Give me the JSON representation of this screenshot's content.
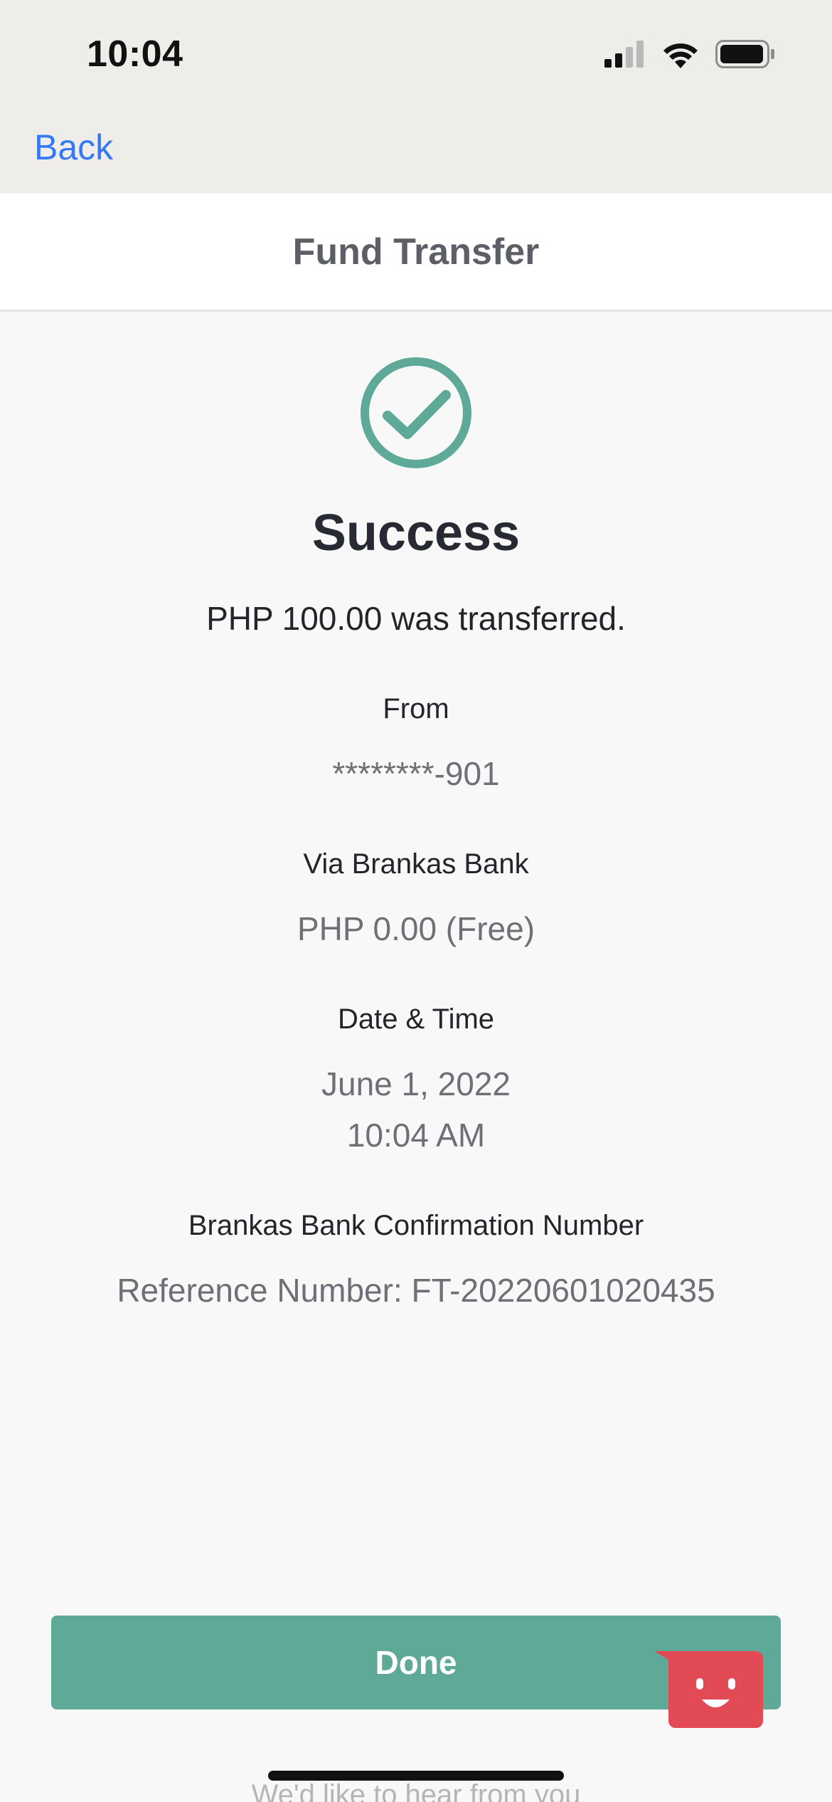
{
  "status_bar": {
    "time": "10:04"
  },
  "nav": {
    "back_label": "Back"
  },
  "header": {
    "title": "Fund Transfer"
  },
  "result": {
    "title": "Success",
    "message": "PHP 100.00 was transferred.",
    "from_label": "From",
    "from_value": "********-901",
    "via_label": "Via Brankas Bank",
    "fee_value": "PHP 0.00 (Free)",
    "datetime_label": "Date & Time",
    "date_value": "June 1, 2022",
    "time_value": "10:04 AM",
    "confirmation_label": "Brankas Bank Confirmation Number",
    "reference_value": "Reference Number: FT-20220601020435"
  },
  "actions": {
    "done_label": "Done"
  },
  "feedback": {
    "teaser_text": "We'd like to hear from you"
  },
  "colors": {
    "accent_green": "#5ea997",
    "link_blue": "#3478f6",
    "feedback_red": "#e24a55"
  }
}
